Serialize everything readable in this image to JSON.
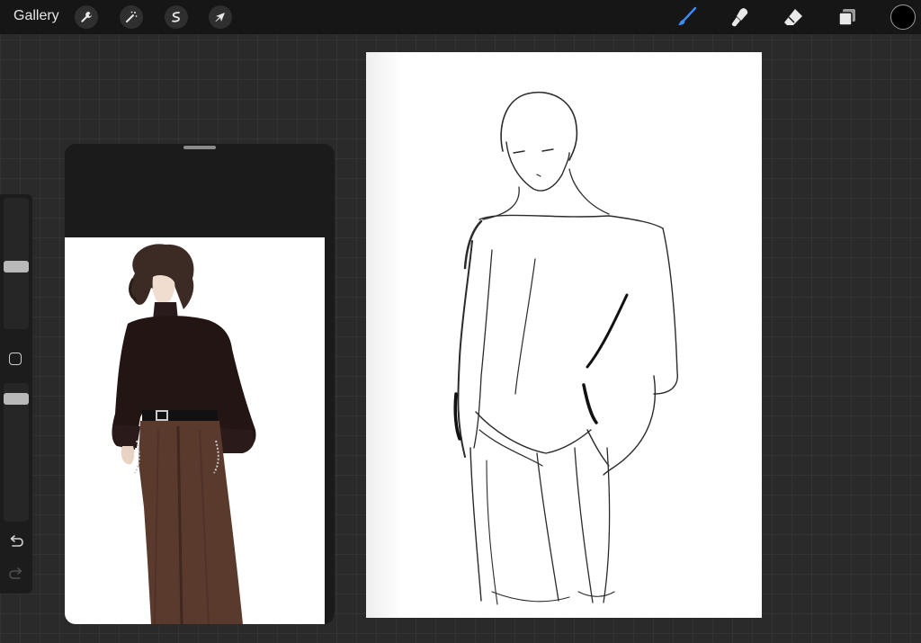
{
  "topbar": {
    "gallery_label": "Gallery",
    "left_tools": [
      {
        "name": "actions",
        "icon": "wrench-icon"
      },
      {
        "name": "adjustments",
        "icon": "magic-wand-icon"
      },
      {
        "name": "selection",
        "icon": "selection-s-icon"
      },
      {
        "name": "transform",
        "icon": "arrow-cursor-icon"
      }
    ],
    "right_tools": [
      {
        "name": "brush",
        "icon": "brush-icon",
        "active": true
      },
      {
        "name": "smudge",
        "icon": "smudge-icon",
        "active": false
      },
      {
        "name": "eraser",
        "icon": "eraser-icon",
        "active": false
      },
      {
        "name": "layers",
        "icon": "layers-icon",
        "active": false
      }
    ],
    "current_color": "#000000",
    "accent_color": "#3a8dff"
  },
  "sidebar": {
    "brush_size_slider": {
      "icon": "size-slider"
    },
    "modify_button": {
      "icon": "square-icon"
    },
    "opacity_slider": {
      "icon": "opacity-slider"
    },
    "undo": {
      "icon": "undo-icon"
    },
    "redo": {
      "icon": "redo-icon"
    }
  },
  "reference_panel": {
    "image": {
      "subject": "figure-icon"
    }
  },
  "canvas": {
    "background": "#ffffff",
    "sketch": {
      "icon": "figure-sketch"
    }
  }
}
